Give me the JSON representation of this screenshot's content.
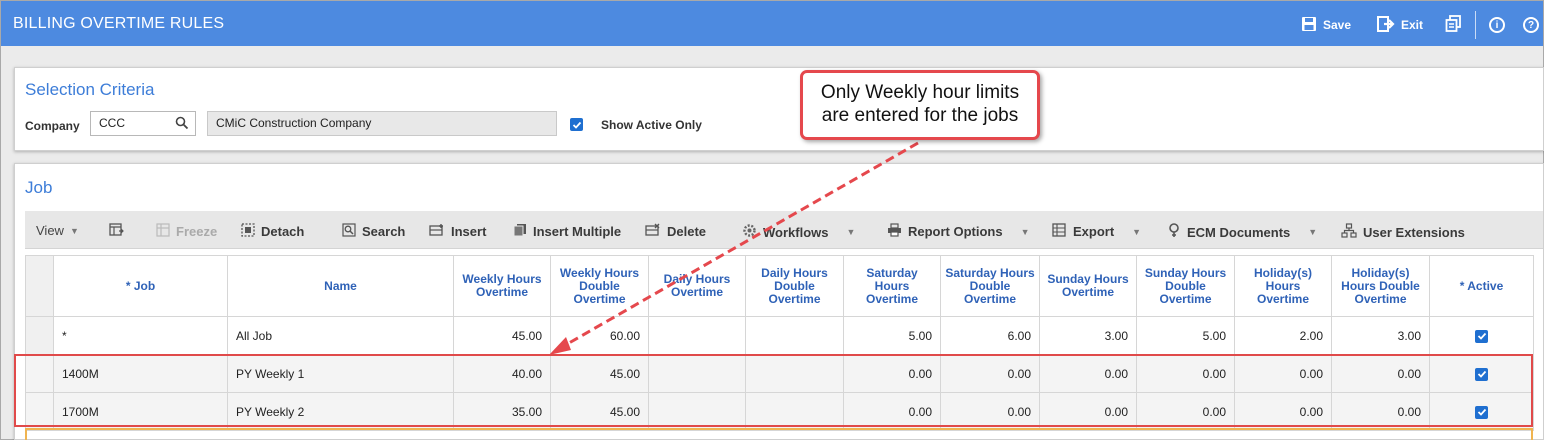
{
  "app": {
    "title": "BILLING OVERTIME RULES",
    "actions": [
      {
        "label": "Save",
        "icon": "save-icon"
      },
      {
        "label": "Exit",
        "icon": "exit-icon"
      }
    ],
    "extra_icons": [
      "copy-icon",
      "info-icon",
      "help-icon"
    ]
  },
  "selection": {
    "title": "Selection Criteria",
    "company_label": "Company",
    "company_value": "CCC",
    "company_name": "CMiC Construction Company",
    "show_active_label": "Show Active Only",
    "show_active_checked": true
  },
  "job_panel": {
    "title": "Job",
    "toolbar": [
      {
        "label": "View",
        "icon": "",
        "dropdown": true,
        "disabled": false
      },
      {
        "label": "",
        "icon": "columns-icon",
        "dropdown": false,
        "disabled": false
      },
      {
        "label": "Freeze",
        "icon": "freeze-icon",
        "dropdown": false,
        "disabled": true
      },
      {
        "label": "Detach",
        "icon": "detach-icon",
        "dropdown": false,
        "disabled": false
      },
      {
        "label": "Search",
        "icon": "search-icon",
        "dropdown": false,
        "disabled": false
      },
      {
        "label": "Insert",
        "icon": "insert-icon",
        "dropdown": false,
        "disabled": false
      },
      {
        "label": "Insert Multiple",
        "icon": "insert-multiple-icon",
        "dropdown": false,
        "disabled": false
      },
      {
        "label": "Delete",
        "icon": "delete-icon",
        "dropdown": false,
        "disabled": false
      },
      {
        "label": "Workflows",
        "icon": "gear-icon",
        "dropdown": true,
        "disabled": false
      },
      {
        "label": "Report Options",
        "icon": "printer-icon",
        "dropdown": true,
        "disabled": false
      },
      {
        "label": "Export",
        "icon": "export-icon",
        "dropdown": true,
        "disabled": false
      },
      {
        "label": "ECM Documents",
        "icon": "ecm-icon",
        "dropdown": true,
        "disabled": false
      },
      {
        "label": "User Extensions",
        "icon": "hierarchy-icon",
        "dropdown": false,
        "disabled": false
      }
    ],
    "columns": [
      "* Job",
      "Name",
      "Weekly Hours Overtime",
      "Weekly Hours Double Overtime",
      "Daily Hours Overtime",
      "Daily Hours Double Overtime",
      "Saturday Hours Overtime",
      "Saturday Hours Double Overtime",
      "Sunday Hours Overtime",
      "Sunday Hours Double Overtime",
      "Holiday(s) Hours Overtime",
      "Holiday(s) Hours Double Overtime",
      "* Active"
    ],
    "rows": [
      {
        "job": "*",
        "name": "All Job",
        "values": [
          "45.00",
          "60.00",
          "",
          "",
          "5.00",
          "6.00",
          "3.00",
          "5.00",
          "2.00",
          "3.00"
        ],
        "active": true
      },
      {
        "job": "1400M",
        "name": "PY Weekly 1",
        "values": [
          "40.00",
          "45.00",
          "",
          "",
          "0.00",
          "0.00",
          "0.00",
          "0.00",
          "0.00",
          "0.00"
        ],
        "active": true
      },
      {
        "job": "1700M",
        "name": "PY Weekly 2",
        "values": [
          "35.00",
          "45.00",
          "",
          "",
          "0.00",
          "0.00",
          "0.00",
          "0.00",
          "0.00",
          "0.00"
        ],
        "active": true
      }
    ]
  },
  "callout": {
    "line1": "Only Weekly hour limits",
    "line2": "are entered for the jobs"
  },
  "colors": {
    "titlebar": "#4d8ae0",
    "accent": "#3d7dd8",
    "highlight": "#e04a4a",
    "checkbox": "#1f6fd0"
  }
}
